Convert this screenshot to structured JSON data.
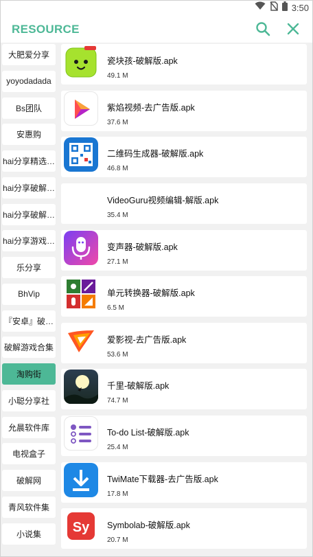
{
  "status": {
    "time": "3:50",
    "icons": [
      "wifi-icon",
      "no-sim-icon",
      "battery-icon"
    ]
  },
  "appbar": {
    "title": "RESOURCE",
    "icons": [
      "search-icon",
      "close-icon"
    ]
  },
  "colors": {
    "accent": "#4db896",
    "background": "#f1f1f1",
    "card": "#ffffff"
  },
  "sidebar": {
    "items": [
      {
        "label": "大肥爱分享",
        "active": false
      },
      {
        "label": "yoyodadada",
        "active": false
      },
      {
        "label": "Bs团队",
        "active": false
      },
      {
        "label": "安惠购",
        "active": false
      },
      {
        "label": "hai分享精选…",
        "active": false
      },
      {
        "label": "hai分享破解…",
        "active": false
      },
      {
        "label": "hai分享破解…",
        "active": false
      },
      {
        "label": "hai分享游戏…",
        "active": false
      },
      {
        "label": "乐分享",
        "active": false
      },
      {
        "label": "BhVip",
        "active": false
      },
      {
        "label": "『安卓』破…",
        "active": false
      },
      {
        "label": "破解游戏合集",
        "active": false
      },
      {
        "label": "淘购街",
        "active": true
      },
      {
        "label": "小聪分享社",
        "active": false
      },
      {
        "label": "允晨软件库",
        "active": false
      },
      {
        "label": "电视盒子",
        "active": false
      },
      {
        "label": "破解网",
        "active": false
      },
      {
        "label": "青风软件集",
        "active": false
      },
      {
        "label": "小说集",
        "active": false
      }
    ]
  },
  "files": [
    {
      "name": "瓷块孩-破解版.apk",
      "size": "49.1 M",
      "icon": "slime-face-app-icon"
    },
    {
      "name": "紫焰视频-去广告版.apk",
      "size": "37.6 M",
      "icon": "video-play-app-icon"
    },
    {
      "name": "二维码生成器-破解版.apk",
      "size": "46.8 M",
      "icon": "qr-code-app-icon"
    },
    {
      "name": "VideoGuru视频编辑-解版.apk",
      "size": "35.4 M",
      "icon": ""
    },
    {
      "name": "变声器-破解版.apk",
      "size": "27.1 M",
      "icon": "microphone-app-icon"
    },
    {
      "name": "单元转换器-破解版.apk",
      "size": "6.5 M",
      "icon": "unit-converter-app-icon"
    },
    {
      "name": "爱影视-去广告版.apk",
      "size": "53.6 M",
      "icon": "swoosh-app-icon"
    },
    {
      "name": "千里-破解版.apk",
      "size": "74.7 M",
      "icon": "moon-night-app-icon"
    },
    {
      "name": "To-do List-破解版.apk",
      "size": "25.4 M",
      "icon": "todo-list-app-icon"
    },
    {
      "name": "TwiMate下载器-去广告版.apk",
      "size": "17.8 M",
      "icon": "download-arrow-app-icon"
    },
    {
      "name": "Symbolab-破解版.apk",
      "size": "20.7 M",
      "icon": "symbolab-sy-app-icon",
      "icon_text": "Sy"
    }
  ]
}
